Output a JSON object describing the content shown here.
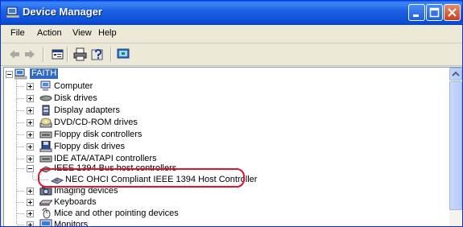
{
  "window": {
    "title": "Device Manager"
  },
  "menu": [
    {
      "label": "File"
    },
    {
      "label": "Action"
    },
    {
      "label": "View"
    },
    {
      "label": "Help"
    }
  ],
  "toolbar": [
    "back-arrow",
    "forward-arrow",
    "properties",
    "print",
    "help",
    "scan-hardware"
  ],
  "tree": {
    "root": "FAITH",
    "items": [
      {
        "label": "Computer",
        "icon": "computer-icon",
        "expanded": false
      },
      {
        "label": "Disk drives",
        "icon": "disk-drive-icon",
        "expanded": false
      },
      {
        "label": "Display adapters",
        "icon": "display-adapter-icon",
        "expanded": false
      },
      {
        "label": "DVD/CD-ROM drives",
        "icon": "dvd-drive-icon",
        "expanded": false
      },
      {
        "label": "Floppy disk controllers",
        "icon": "controller-icon",
        "expanded": false
      },
      {
        "label": "Floppy disk drives",
        "icon": "floppy-drive-icon",
        "expanded": false
      },
      {
        "label": "IDE ATA/ATAPI controllers",
        "icon": "controller-icon",
        "expanded": false
      },
      {
        "label": "IEEE 1394 Bus host controllers",
        "icon": "ieee1394-icon",
        "expanded": true
      },
      {
        "label": "Imaging devices",
        "icon": "camera-icon",
        "expanded": false
      },
      {
        "label": "Keyboards",
        "icon": "keyboard-icon",
        "expanded": false
      },
      {
        "label": "Mice and other pointing devices",
        "icon": "mouse-icon",
        "expanded": false
      },
      {
        "label": "Monitors",
        "icon": "monitor-icon",
        "expanded": false
      }
    ],
    "child": {
      "label": "NEC OHCI Compliant IEEE 1394 Host Controller",
      "icon": "ieee1394-icon"
    }
  },
  "colors": {
    "titlebar": "#0a4ed6",
    "selection": "#316ac5",
    "highlight": "#e0142d"
  }
}
